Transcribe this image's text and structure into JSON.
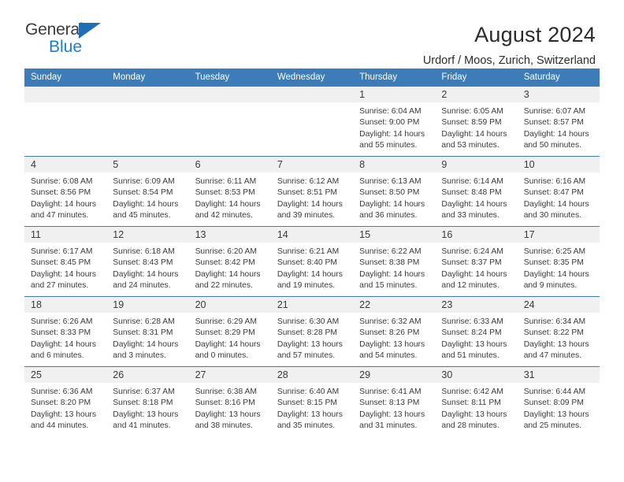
{
  "brand": {
    "name_part1": "General",
    "name_part2": "Blue",
    "triangle_color": "#1f6fb5",
    "blue_color": "#1a7fd4"
  },
  "header": {
    "title": "August 2024",
    "subtitle": "Urdorf / Moos, Zurich, Switzerland"
  },
  "colors": {
    "header_bar": "#3c7cb8",
    "day_band": "#f0f0f0",
    "text": "#3a3a3a"
  },
  "weekdays": [
    "Sunday",
    "Monday",
    "Tuesday",
    "Wednesday",
    "Thursday",
    "Friday",
    "Saturday"
  ],
  "weeks": [
    [
      {
        "day": "",
        "sunrise": "",
        "sunset": "",
        "daylight1": "",
        "daylight2": ""
      },
      {
        "day": "",
        "sunrise": "",
        "sunset": "",
        "daylight1": "",
        "daylight2": ""
      },
      {
        "day": "",
        "sunrise": "",
        "sunset": "",
        "daylight1": "",
        "daylight2": ""
      },
      {
        "day": "",
        "sunrise": "",
        "sunset": "",
        "daylight1": "",
        "daylight2": ""
      },
      {
        "day": "1",
        "sunrise": "Sunrise: 6:04 AM",
        "sunset": "Sunset: 9:00 PM",
        "daylight1": "Daylight: 14 hours",
        "daylight2": "and 55 minutes."
      },
      {
        "day": "2",
        "sunrise": "Sunrise: 6:05 AM",
        "sunset": "Sunset: 8:59 PM",
        "daylight1": "Daylight: 14 hours",
        "daylight2": "and 53 minutes."
      },
      {
        "day": "3",
        "sunrise": "Sunrise: 6:07 AM",
        "sunset": "Sunset: 8:57 PM",
        "daylight1": "Daylight: 14 hours",
        "daylight2": "and 50 minutes."
      }
    ],
    [
      {
        "day": "4",
        "sunrise": "Sunrise: 6:08 AM",
        "sunset": "Sunset: 8:56 PM",
        "daylight1": "Daylight: 14 hours",
        "daylight2": "and 47 minutes."
      },
      {
        "day": "5",
        "sunrise": "Sunrise: 6:09 AM",
        "sunset": "Sunset: 8:54 PM",
        "daylight1": "Daylight: 14 hours",
        "daylight2": "and 45 minutes."
      },
      {
        "day": "6",
        "sunrise": "Sunrise: 6:11 AM",
        "sunset": "Sunset: 8:53 PM",
        "daylight1": "Daylight: 14 hours",
        "daylight2": "and 42 minutes."
      },
      {
        "day": "7",
        "sunrise": "Sunrise: 6:12 AM",
        "sunset": "Sunset: 8:51 PM",
        "daylight1": "Daylight: 14 hours",
        "daylight2": "and 39 minutes."
      },
      {
        "day": "8",
        "sunrise": "Sunrise: 6:13 AM",
        "sunset": "Sunset: 8:50 PM",
        "daylight1": "Daylight: 14 hours",
        "daylight2": "and 36 minutes."
      },
      {
        "day": "9",
        "sunrise": "Sunrise: 6:14 AM",
        "sunset": "Sunset: 8:48 PM",
        "daylight1": "Daylight: 14 hours",
        "daylight2": "and 33 minutes."
      },
      {
        "day": "10",
        "sunrise": "Sunrise: 6:16 AM",
        "sunset": "Sunset: 8:47 PM",
        "daylight1": "Daylight: 14 hours",
        "daylight2": "and 30 minutes."
      }
    ],
    [
      {
        "day": "11",
        "sunrise": "Sunrise: 6:17 AM",
        "sunset": "Sunset: 8:45 PM",
        "daylight1": "Daylight: 14 hours",
        "daylight2": "and 27 minutes."
      },
      {
        "day": "12",
        "sunrise": "Sunrise: 6:18 AM",
        "sunset": "Sunset: 8:43 PM",
        "daylight1": "Daylight: 14 hours",
        "daylight2": "and 24 minutes."
      },
      {
        "day": "13",
        "sunrise": "Sunrise: 6:20 AM",
        "sunset": "Sunset: 8:42 PM",
        "daylight1": "Daylight: 14 hours",
        "daylight2": "and 22 minutes."
      },
      {
        "day": "14",
        "sunrise": "Sunrise: 6:21 AM",
        "sunset": "Sunset: 8:40 PM",
        "daylight1": "Daylight: 14 hours",
        "daylight2": "and 19 minutes."
      },
      {
        "day": "15",
        "sunrise": "Sunrise: 6:22 AM",
        "sunset": "Sunset: 8:38 PM",
        "daylight1": "Daylight: 14 hours",
        "daylight2": "and 15 minutes."
      },
      {
        "day": "16",
        "sunrise": "Sunrise: 6:24 AM",
        "sunset": "Sunset: 8:37 PM",
        "daylight1": "Daylight: 14 hours",
        "daylight2": "and 12 minutes."
      },
      {
        "day": "17",
        "sunrise": "Sunrise: 6:25 AM",
        "sunset": "Sunset: 8:35 PM",
        "daylight1": "Daylight: 14 hours",
        "daylight2": "and 9 minutes."
      }
    ],
    [
      {
        "day": "18",
        "sunrise": "Sunrise: 6:26 AM",
        "sunset": "Sunset: 8:33 PM",
        "daylight1": "Daylight: 14 hours",
        "daylight2": "and 6 minutes."
      },
      {
        "day": "19",
        "sunrise": "Sunrise: 6:28 AM",
        "sunset": "Sunset: 8:31 PM",
        "daylight1": "Daylight: 14 hours",
        "daylight2": "and 3 minutes."
      },
      {
        "day": "20",
        "sunrise": "Sunrise: 6:29 AM",
        "sunset": "Sunset: 8:29 PM",
        "daylight1": "Daylight: 14 hours",
        "daylight2": "and 0 minutes."
      },
      {
        "day": "21",
        "sunrise": "Sunrise: 6:30 AM",
        "sunset": "Sunset: 8:28 PM",
        "daylight1": "Daylight: 13 hours",
        "daylight2": "and 57 minutes."
      },
      {
        "day": "22",
        "sunrise": "Sunrise: 6:32 AM",
        "sunset": "Sunset: 8:26 PM",
        "daylight1": "Daylight: 13 hours",
        "daylight2": "and 54 minutes."
      },
      {
        "day": "23",
        "sunrise": "Sunrise: 6:33 AM",
        "sunset": "Sunset: 8:24 PM",
        "daylight1": "Daylight: 13 hours",
        "daylight2": "and 51 minutes."
      },
      {
        "day": "24",
        "sunrise": "Sunrise: 6:34 AM",
        "sunset": "Sunset: 8:22 PM",
        "daylight1": "Daylight: 13 hours",
        "daylight2": "and 47 minutes."
      }
    ],
    [
      {
        "day": "25",
        "sunrise": "Sunrise: 6:36 AM",
        "sunset": "Sunset: 8:20 PM",
        "daylight1": "Daylight: 13 hours",
        "daylight2": "and 44 minutes."
      },
      {
        "day": "26",
        "sunrise": "Sunrise: 6:37 AM",
        "sunset": "Sunset: 8:18 PM",
        "daylight1": "Daylight: 13 hours",
        "daylight2": "and 41 minutes."
      },
      {
        "day": "27",
        "sunrise": "Sunrise: 6:38 AM",
        "sunset": "Sunset: 8:16 PM",
        "daylight1": "Daylight: 13 hours",
        "daylight2": "and 38 minutes."
      },
      {
        "day": "28",
        "sunrise": "Sunrise: 6:40 AM",
        "sunset": "Sunset: 8:15 PM",
        "daylight1": "Daylight: 13 hours",
        "daylight2": "and 35 minutes."
      },
      {
        "day": "29",
        "sunrise": "Sunrise: 6:41 AM",
        "sunset": "Sunset: 8:13 PM",
        "daylight1": "Daylight: 13 hours",
        "daylight2": "and 31 minutes."
      },
      {
        "day": "30",
        "sunrise": "Sunrise: 6:42 AM",
        "sunset": "Sunset: 8:11 PM",
        "daylight1": "Daylight: 13 hours",
        "daylight2": "and 28 minutes."
      },
      {
        "day": "31",
        "sunrise": "Sunrise: 6:44 AM",
        "sunset": "Sunset: 8:09 PM",
        "daylight1": "Daylight: 13 hours",
        "daylight2": "and 25 minutes."
      }
    ]
  ]
}
